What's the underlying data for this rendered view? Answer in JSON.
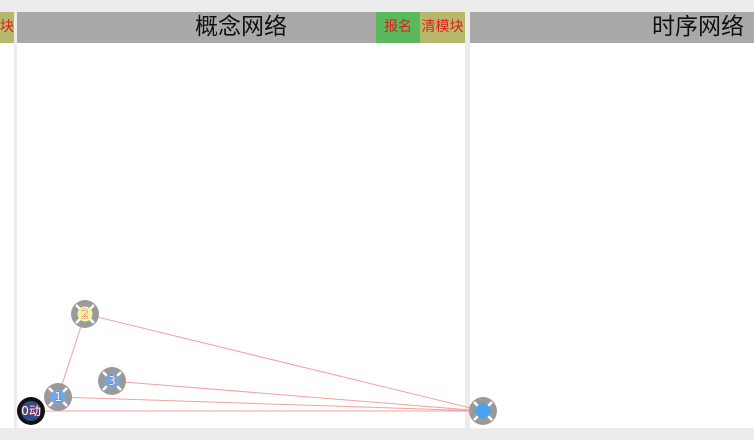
{
  "left_stub": {
    "button_label": "块"
  },
  "concept_panel": {
    "title": "概念网络",
    "signup_label": "报名",
    "clear_label": "清模块"
  },
  "timeline_panel": {
    "title": "时序网络"
  },
  "nodes": [
    {
      "id": "node-0",
      "label": "0动"
    },
    {
      "id": "node-1",
      "label": "1"
    },
    {
      "id": "node-2",
      "label": "2"
    },
    {
      "id": "node-3",
      "label": "3"
    },
    {
      "id": "node-hub",
      "label": ""
    }
  ],
  "colors": {
    "header": "#a9a9a9",
    "signup_button": "#5cb85c",
    "clear_button": "#b7b86a",
    "edge": "#f4a0a0",
    "button_text": "#e01c1c"
  }
}
